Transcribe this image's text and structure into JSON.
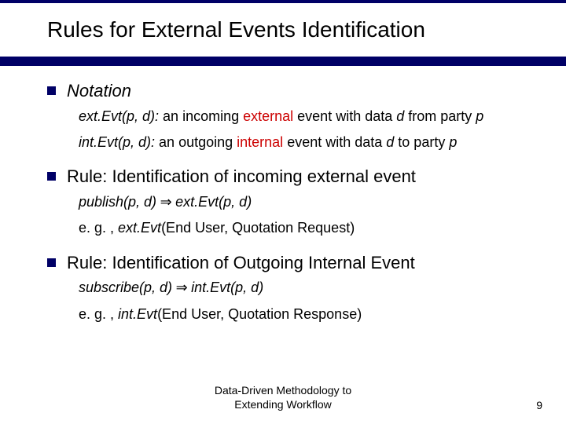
{
  "title": "Rules for External Events Identification",
  "sections": [
    {
      "heading": "Notation",
      "subs": [
        {
          "prefix": "ext.Evt(p, d): ",
          "text1": "an incoming ",
          "highlight": "external",
          "text2": " event with data ",
          "d": "d",
          "text3": " from party ",
          "p": "p"
        },
        {
          "prefix": "int.Evt(p, d): ",
          "text1": "an outgoing ",
          "highlight": "internal",
          "text2": " event with data ",
          "d": "d",
          "text3": " to party ",
          "p": "p"
        }
      ]
    },
    {
      "heading": "Rule: Identification of incoming external event",
      "subs": [
        {
          "lhs": "publish(p, d)",
          "imp": " ⇒ ",
          "rhs": "ext.Evt(p, d)"
        },
        {
          "eg": "e. g. , ",
          "ital": "ext.Evt",
          "rest": "(End User, Quotation Request)"
        }
      ]
    },
    {
      "heading": "Rule: Identification of Outgoing Internal Event",
      "subs": [
        {
          "lhs": "subscribe(p, d)",
          "imp": " ⇒ ",
          "rhs": "int.Evt(p, d)"
        },
        {
          "eg": "e. g. , ",
          "ital": "int.Evt",
          "rest": "(End User, Quotation Response)"
        }
      ]
    }
  ],
  "footer": {
    "line1": "Data-Driven Methodology to",
    "line2": "Extending Workflow"
  },
  "page": "9"
}
